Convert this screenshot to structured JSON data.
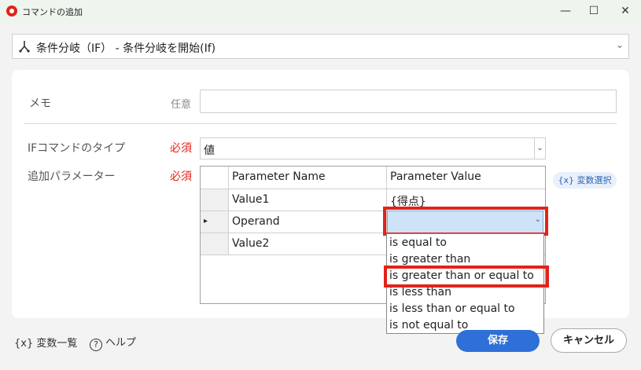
{
  "window": {
    "title": "コマンドの追加",
    "min_glyph": "—",
    "max_glyph": "☐",
    "close_glyph": "✕"
  },
  "command": {
    "text": "条件分岐（IF） - 条件分岐を開始(If)",
    "chevron": "⌄",
    "icon": "branch-icon"
  },
  "memo": {
    "label": "メモ",
    "optional": "任意",
    "value": ""
  },
  "if_type": {
    "label": "IFコマンドのタイプ",
    "required": "必須",
    "value": "値",
    "chevron": "⌄"
  },
  "params": {
    "label": "追加パラメーター",
    "required": "必須",
    "columns": [
      "Parameter Name",
      "Parameter Value"
    ],
    "rows": [
      {
        "name": "Value1",
        "value": "{得点}",
        "indicator": ""
      },
      {
        "name": "Operand",
        "value": "",
        "indicator": "▸"
      },
      {
        "name": "Value2",
        "value": "",
        "indicator": ""
      }
    ]
  },
  "var_select": {
    "label": "{x} 変数選択"
  },
  "combo": {
    "chevron": "⌄"
  },
  "dropdown": {
    "options": [
      "is equal to",
      "is greater than",
      "is greater than or equal to",
      "is less than",
      "is less than or equal to",
      "is not equal to"
    ],
    "highlighted_index": 2
  },
  "footer": {
    "var_list": "{x}  変数一覧",
    "help_glyph": "?",
    "help": "ヘルプ",
    "save": "保存",
    "cancel": "キャンセル"
  },
  "colors": {
    "accent": "#2f6fd8",
    "required": "#e2231a",
    "highlight_box": "#e2231a"
  }
}
